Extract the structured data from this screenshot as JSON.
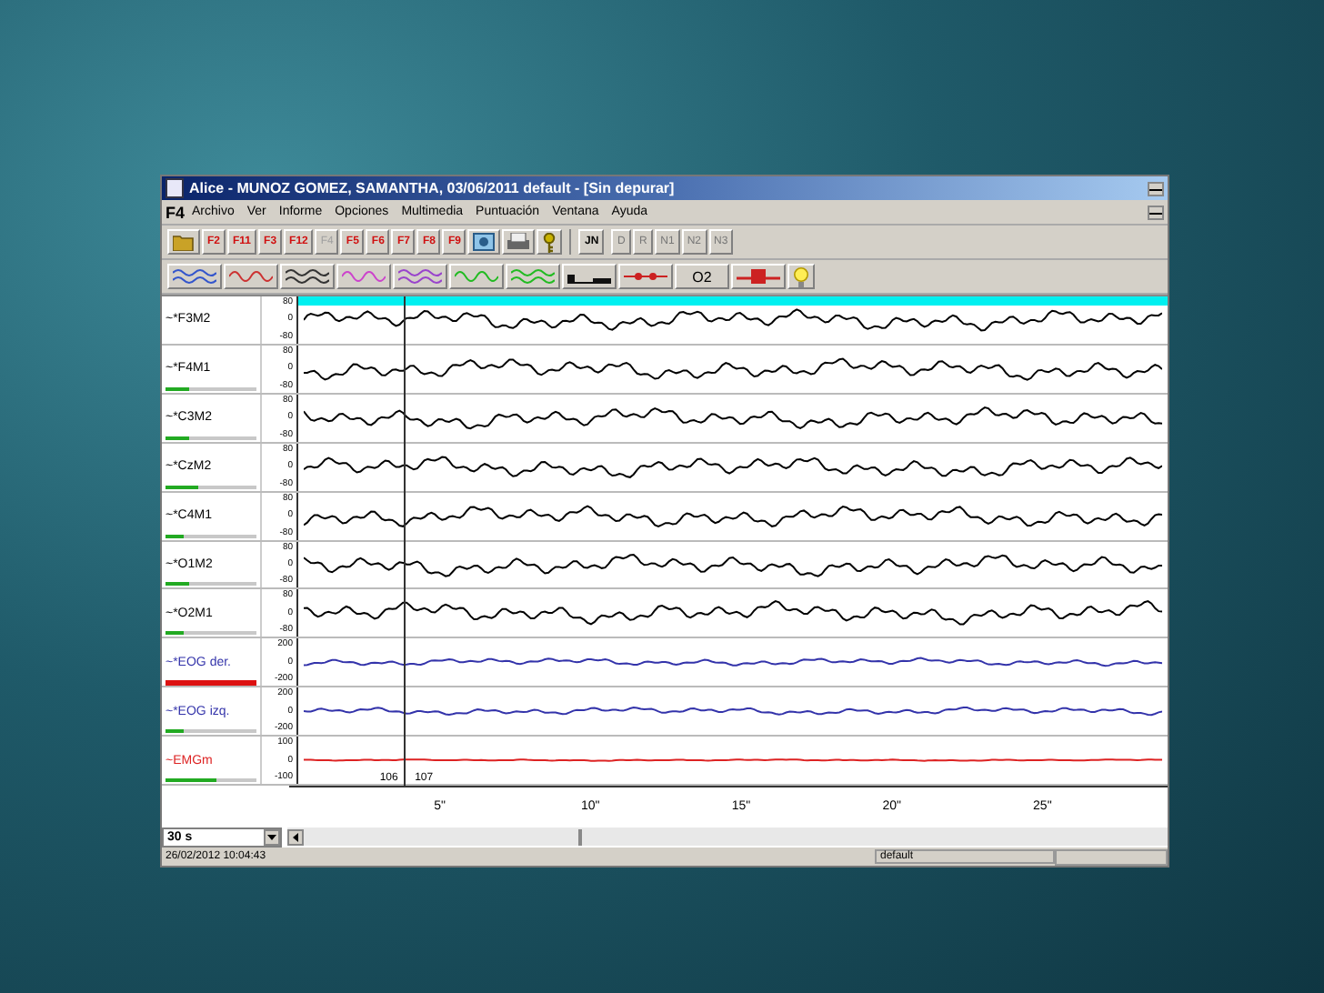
{
  "window": {
    "title": "Alice - MUNOZ GOMEZ, SAMANTHA, 03/06/2011 default - [Sin depurar]"
  },
  "menu": {
    "logo": "F4",
    "items": [
      "Archivo",
      "Ver",
      "Informe",
      "Opciones",
      "Multimedia",
      "Puntuación",
      "Ventana",
      "Ayuda"
    ]
  },
  "toolbar": {
    "function_keys": [
      {
        "label": "F2",
        "disabled": false
      },
      {
        "label": "F11",
        "disabled": false
      },
      {
        "label": "F3",
        "disabled": false
      },
      {
        "label": "F12",
        "disabled": false
      },
      {
        "label": "F4",
        "disabled": true
      },
      {
        "label": "F5",
        "disabled": false
      },
      {
        "label": "F6",
        "disabled": false
      },
      {
        "label": "F7",
        "disabled": false
      },
      {
        "label": "F8",
        "disabled": false
      },
      {
        "label": "F9",
        "disabled": false
      }
    ],
    "mode_button": "JN",
    "stages": [
      {
        "label": "D",
        "disabled": true
      },
      {
        "label": "R",
        "disabled": true
      },
      {
        "label": "N1",
        "disabled": true
      },
      {
        "label": "N2",
        "disabled": true
      },
      {
        "label": "N3",
        "disabled": true
      }
    ]
  },
  "toolbar2": {
    "o2_button": "O2"
  },
  "channels": [
    {
      "name": "~*F3M2",
      "color": "#000000",
      "scale": [
        "80",
        "0",
        "-80"
      ]
    },
    {
      "name": "~*F4M1",
      "color": "#000000",
      "scale": [
        "80",
        "0",
        "-80"
      ],
      "level": 0.25,
      "alert": false
    },
    {
      "name": "~*C3M2",
      "color": "#000000",
      "scale": [
        "80",
        "0",
        "-80"
      ],
      "level": 0.25,
      "alert": false
    },
    {
      "name": "~*CzM2",
      "color": "#000000",
      "scale": [
        "80",
        "0",
        "-80"
      ],
      "level": 0.35,
      "alert": false
    },
    {
      "name": "~*C4M1",
      "color": "#000000",
      "scale": [
        "80",
        "0",
        "-80"
      ],
      "level": 0.2,
      "alert": false
    },
    {
      "name": "~*O1M2",
      "color": "#000000",
      "scale": [
        "80",
        "0",
        "-80"
      ],
      "level": 0.25,
      "alert": false
    },
    {
      "name": "~*O2M1",
      "color": "#000000",
      "scale": [
        "80",
        "0",
        "-80"
      ],
      "level": 0.2,
      "alert": false
    },
    {
      "name": "~*EOG der.",
      "color": "#3333aa",
      "scale": [
        "200",
        "0",
        "-200"
      ],
      "level": 1,
      "alert": true
    },
    {
      "name": "~*EOG izq.",
      "color": "#3333aa",
      "scale": [
        "200",
        "0",
        "-200"
      ],
      "level": 0.2,
      "alert": false
    },
    {
      "name": "~EMGm",
      "color": "#dd2222",
      "scale": [
        "100",
        "0",
        "-100"
      ],
      "level": 0.55,
      "alert": false
    }
  ],
  "time_axis": {
    "epochs": [
      "106",
      "107"
    ],
    "ticks": [
      "5\"",
      "10\"",
      "15\"",
      "20\"",
      "25\""
    ]
  },
  "window_length": "30 s",
  "status_bar": {
    "datetime": "26/02/2012 10:04:43",
    "profile": "default"
  }
}
